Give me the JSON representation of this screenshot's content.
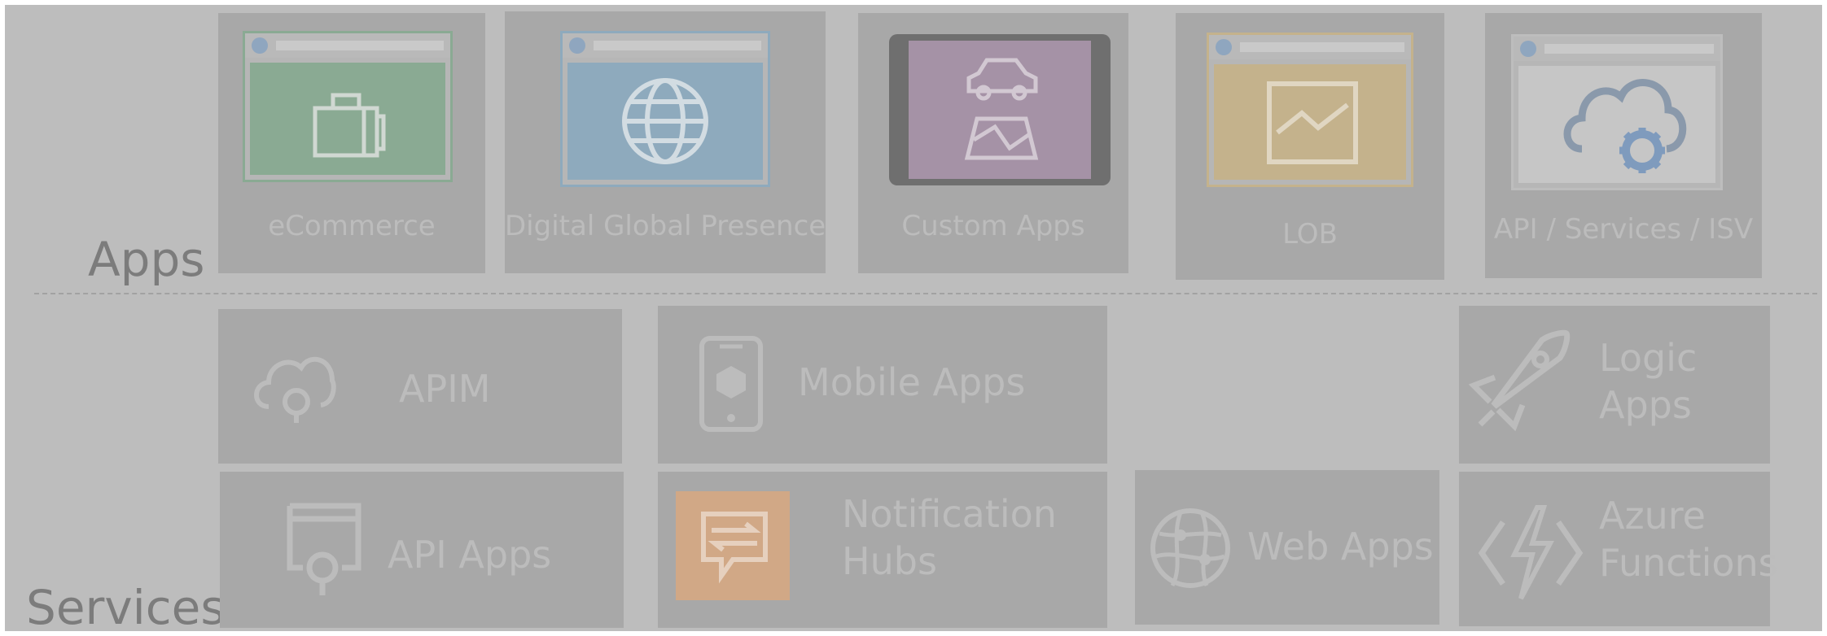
{
  "sections": {
    "apps": "Apps",
    "services": "Services"
  },
  "apps": [
    {
      "label": "eCommerce",
      "icon": "briefcase-icon",
      "color": "#8aaa93"
    },
    {
      "label": "Digital Global Presence",
      "icon": "globe-icon",
      "color": "#8eaabd"
    },
    {
      "label": "Custom Apps",
      "icon": "car-map-icon",
      "color": "#a592a6"
    },
    {
      "label": "LOB",
      "icon": "chart-window-icon",
      "color": "#c4b28c"
    },
    {
      "label": "API / Services / ISV",
      "icon": "cloud-gear-icon",
      "color": "#c6c6c6"
    }
  ],
  "services": [
    {
      "label": "APIM",
      "icon": "cloud-api-icon"
    },
    {
      "label": "Mobile Apps",
      "icon": "phone-cube-icon"
    },
    {
      "label_line1": "Logic",
      "label_line2": "Apps",
      "icon": "rocket-icon"
    },
    {
      "label": "API Apps",
      "icon": "api-window-icon"
    },
    {
      "label_line1": "Notification",
      "label_line2": "Hubs",
      "icon": "notification-hub-icon",
      "color": "#d1a886"
    },
    {
      "label": "Web Apps",
      "icon": "web-globe-icon"
    },
    {
      "label_line1": "Azure",
      "label_line2": "Functions",
      "icon": "lightning-brackets-icon"
    }
  ]
}
